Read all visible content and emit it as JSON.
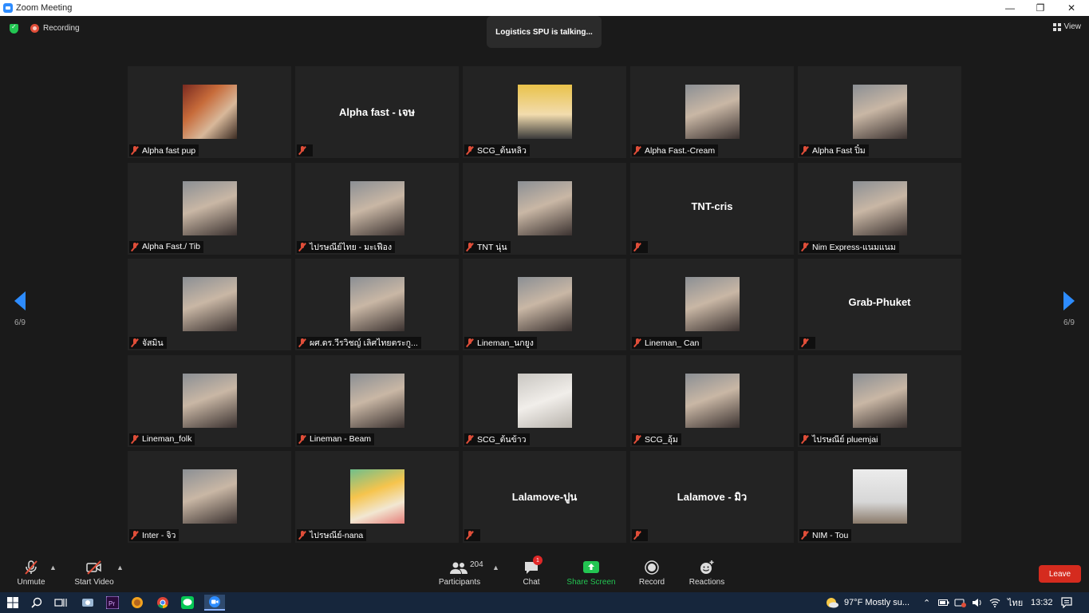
{
  "window": {
    "title": "Zoom Meeting"
  },
  "status": {
    "recording_label": "Recording",
    "talking_text": "Logistics SPU is talking...",
    "view_label": "View"
  },
  "pager": {
    "left_label": "6/9",
    "right_label": "6/9"
  },
  "colors": {
    "accent": "#2d8cff",
    "muted": "#e04e39",
    "leave": "#d52b1e",
    "share": "#23c552"
  },
  "participants": [
    {
      "label": "Alpha fast pup",
      "big_name": "",
      "photo": "ironman-photo"
    },
    {
      "label": "",
      "big_name": "Alpha fast - เจษ",
      "photo": ""
    },
    {
      "label": "SCG_ต้นหลิว",
      "big_name": "",
      "photo": "anime-photo"
    },
    {
      "label": "Alpha Fast.-Cream",
      "big_name": "",
      "photo": "person-photo"
    },
    {
      "label": "Alpha Fast ปิ๋ม",
      "big_name": "",
      "photo": "person-photo"
    },
    {
      "label": "Alpha Fast./ Tib",
      "big_name": "",
      "photo": "person-photo"
    },
    {
      "label": "ไปรษณีย์ไทย - มะเฟือง",
      "big_name": "",
      "photo": "person-photo"
    },
    {
      "label": "TNT นุ่น",
      "big_name": "",
      "photo": "person-photo"
    },
    {
      "label": "",
      "big_name": "TNT-cris",
      "photo": ""
    },
    {
      "label": "Nim Express-แนมแนม",
      "big_name": "",
      "photo": "person-photo"
    },
    {
      "label": "จัสมิน",
      "big_name": "",
      "photo": "person-photo"
    },
    {
      "label": "ผศ.ดร.วีรวิชญ์ เลิศไทยตระกู...",
      "big_name": "",
      "photo": "person-photo"
    },
    {
      "label": "Lineman_นกยูง",
      "big_name": "",
      "photo": "person-photo"
    },
    {
      "label": "Lineman_ Can",
      "big_name": "",
      "photo": "person-photo"
    },
    {
      "label": "",
      "big_name": "Grab-Phuket",
      "photo": ""
    },
    {
      "label": "Lineman_folk",
      "big_name": "",
      "photo": "person-photo"
    },
    {
      "label": "Lineman - Beam",
      "big_name": "",
      "photo": "person-photo"
    },
    {
      "label": "SCG_ต้นข้าว",
      "big_name": "",
      "photo": "cat-photo"
    },
    {
      "label": "SCG_อุ้ม",
      "big_name": "",
      "photo": "person-photo"
    },
    {
      "label": "ไปรษณีย์ pluemjai",
      "big_name": "",
      "photo": "person-photo"
    },
    {
      "label": "Inter - จิว",
      "big_name": "",
      "photo": "person-photo"
    },
    {
      "label": "ไปรษณีย์-nana",
      "big_name": "",
      "photo": "cartoon-photo"
    },
    {
      "label": "",
      "big_name": "Lalamove-ปูน",
      "photo": ""
    },
    {
      "label": "",
      "big_name": "Lalamove - มิว",
      "photo": ""
    },
    {
      "label": "NIM - Tou",
      "big_name": "",
      "photo": "room-photo"
    }
  ],
  "toolbar": {
    "unmute": "Unmute",
    "start_video": "Start Video",
    "participants": "Participants",
    "participant_count": "204",
    "chat": "Chat",
    "chat_badge": "1",
    "share_screen": "Share Screen",
    "record": "Record",
    "reactions": "Reactions",
    "leave": "Leave"
  },
  "taskbar": {
    "weather": "97°F  Mostly su...",
    "language": "ไทย",
    "time": "13:32"
  }
}
